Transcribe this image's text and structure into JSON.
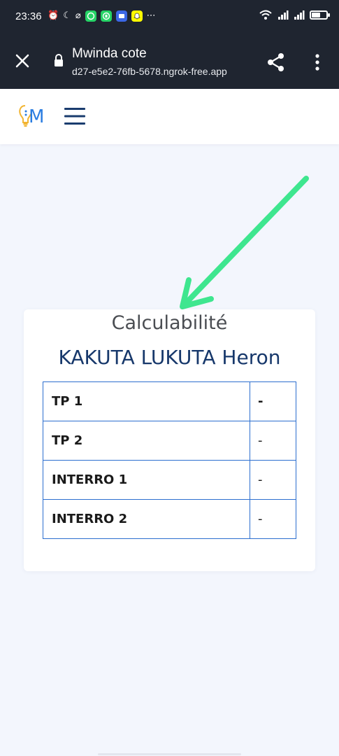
{
  "status_bar": {
    "time": "23:36",
    "icons_left": [
      "alarm-icon",
      "moon-icon",
      "notifications-off-icon",
      "whatsapp-icon",
      "whatsapp-business-icon",
      "messages-icon",
      "snapchat-icon",
      "more-icon"
    ],
    "icons_right": [
      "wifi-icon",
      "signal-icon",
      "signal-icon",
      "battery-icon"
    ]
  },
  "browser": {
    "page_title": "Mwinda cote",
    "url": "d27-e5e2-76fb-5678.ngrok-free.app",
    "icons": [
      "close-icon",
      "lock-icon",
      "share-icon",
      "more-vert-icon"
    ]
  },
  "site_header": {
    "logo_icon": "lightbulb-m-logo",
    "menu_icon": "hamburger-icon"
  },
  "card": {
    "course": "Calculabilité",
    "student": "KAKUTA LUKUTA Heron",
    "grades": [
      {
        "label": "TP 1",
        "value": "-"
      },
      {
        "label": "TP 2",
        "value": "-"
      },
      {
        "label": "INTERRO 1",
        "value": "-"
      },
      {
        "label": "INTERRO 2",
        "value": "-"
      }
    ]
  },
  "colors": {
    "toolbar_bg": "#1f2530",
    "page_bg": "#f3f6fd",
    "student_name": "#17386b",
    "table_border": "#2c6fcf",
    "arrow": "#3ee68f"
  }
}
